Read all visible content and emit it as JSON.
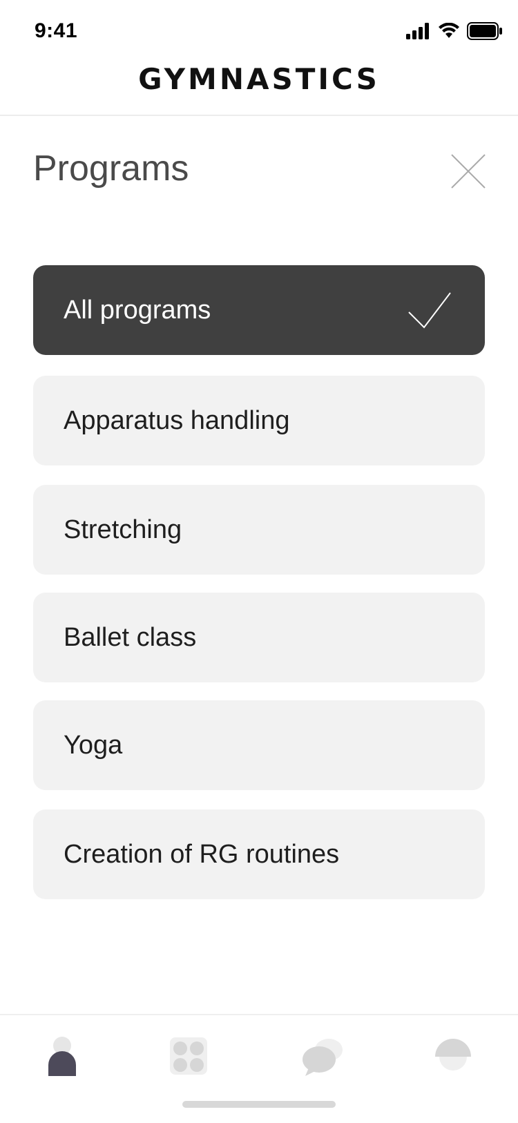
{
  "status_bar": {
    "time": "9:41"
  },
  "app": {
    "title": "GYMNASTICS"
  },
  "sheet": {
    "title": "Programs"
  },
  "programs": [
    {
      "label": "All programs",
      "selected": true
    },
    {
      "label": "Apparatus handling",
      "selected": false
    },
    {
      "label": "Stretching",
      "selected": false
    },
    {
      "label": "Ballet class",
      "selected": false
    },
    {
      "label": "Yoga",
      "selected": false
    },
    {
      "label": "Creation of RG routines",
      "selected": false
    }
  ],
  "tabs": [
    {
      "icon": "profile-icon",
      "active": true
    },
    {
      "icon": "grid-icon",
      "active": false
    },
    {
      "icon": "chat-icon",
      "active": false
    },
    {
      "icon": "dome-icon",
      "active": false
    }
  ],
  "colors": {
    "selected_bg": "#404040",
    "option_bg": "#f2f2f2",
    "active_tab": "#4d4a5a",
    "inactive_tab": "#d6d6d6"
  }
}
